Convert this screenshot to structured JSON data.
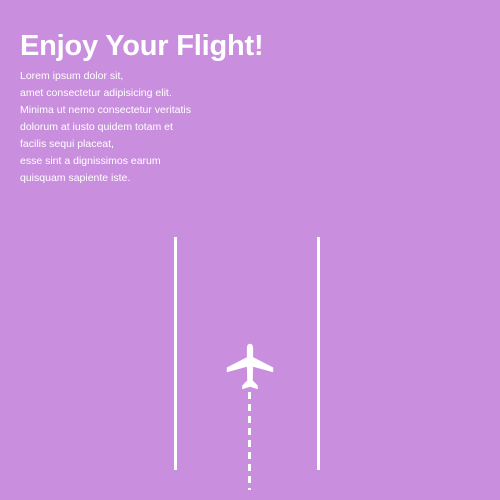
{
  "hero": {
    "title": "Enjoy Your Flight!",
    "paragraph_lines": [
      "Lorem ipsum dolor sit,",
      "amet consectetur adipisicing elit.",
      "Minima ut nemo consectetur veritatis",
      "dolorum at iusto quidem totam et",
      "facilis sequi placeat,",
      "esse sint a dignissimos earum",
      "quisquam sapiente iste."
    ]
  },
  "icons": {
    "plane": "airplane-icon"
  },
  "colors": {
    "background": "#c98fde",
    "foreground": "#ffffff"
  }
}
